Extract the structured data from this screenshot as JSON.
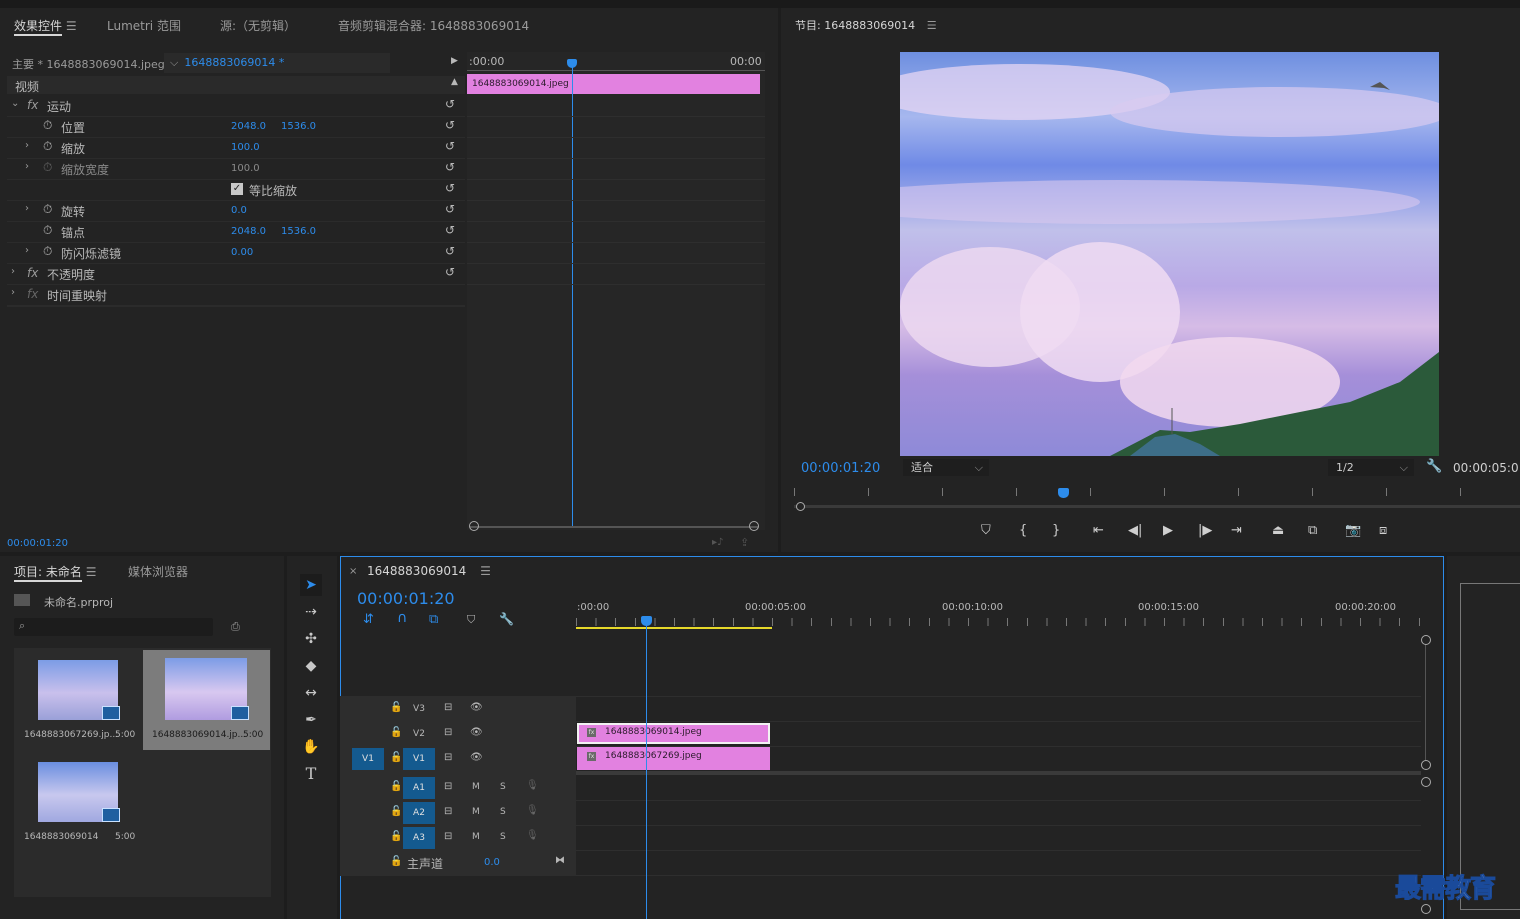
{
  "effects_panel": {
    "tabs": [
      "效果控件",
      "Lumetri 范围",
      "源:（无剪辑）",
      "音频剪辑混合器: 1648883069014"
    ],
    "master_label": "主要 * 1648883069014.jpeg",
    "clip_select": "1648883069014 * 1648883069014.jpeg",
    "timeline_start": ":00:00",
    "timeline_end": "00:00",
    "clip_name": "1648883069014.jpeg",
    "section_video": "视频",
    "rows": [
      {
        "name": "运动"
      },
      {
        "name": "位置",
        "v1": "2048.0",
        "v2": "1536.0"
      },
      {
        "name": "缩放",
        "v1": "100.0"
      },
      {
        "name": "缩放宽度",
        "v1": "100.0"
      },
      {
        "name": "等比缩放"
      },
      {
        "name": "旋转",
        "v1": "0.0"
      },
      {
        "name": "锚点",
        "v1": "2048.0",
        "v2": "1536.0"
      },
      {
        "name": "防闪烁滤镜",
        "v1": "0.00"
      },
      {
        "name": "不透明度"
      },
      {
        "name": "时间重映射"
      }
    ],
    "timecode": "00:00:01:20"
  },
  "program_monitor": {
    "title": "节目: 1648883069014",
    "timecode": "00:00:01:20",
    "fit": "适合",
    "resolution": "1/2",
    "duration": "00:00:05:0"
  },
  "project_panel": {
    "tabs": [
      "项目: 未命名",
      "媒体浏览器"
    ],
    "project_file": "未命名.prproj",
    "items": [
      {
        "name": "1648883067269.jp...",
        "dur": "5:00"
      },
      {
        "name": "1648883069014.jp...",
        "dur": "5:00"
      },
      {
        "name": "1648883069014",
        "dur": "5:00"
      }
    ]
  },
  "timeline": {
    "sequence": "1648883069014",
    "timecode": "00:00:01:20",
    "ruler": [
      ":00:00",
      "00:00:05:00",
      "00:00:10:00",
      "00:00:15:00",
      "00:00:20:00"
    ],
    "video_tracks": [
      "V3",
      "V2",
      "V1"
    ],
    "source_patch": "V1",
    "audio_tracks": [
      "A1",
      "A2",
      "A3"
    ],
    "mute": "M",
    "solo": "S",
    "master": "主声道",
    "master_val": "0.0",
    "clip_v2": "1648883069014.jpeg",
    "clip_v1": "1648883067269.jpeg"
  },
  "watermark": "最需教育",
  "colors": {
    "accent": "#2d8ceb",
    "clip": "#e281e0",
    "panel": "#232323",
    "active_track": "#145a8f"
  }
}
